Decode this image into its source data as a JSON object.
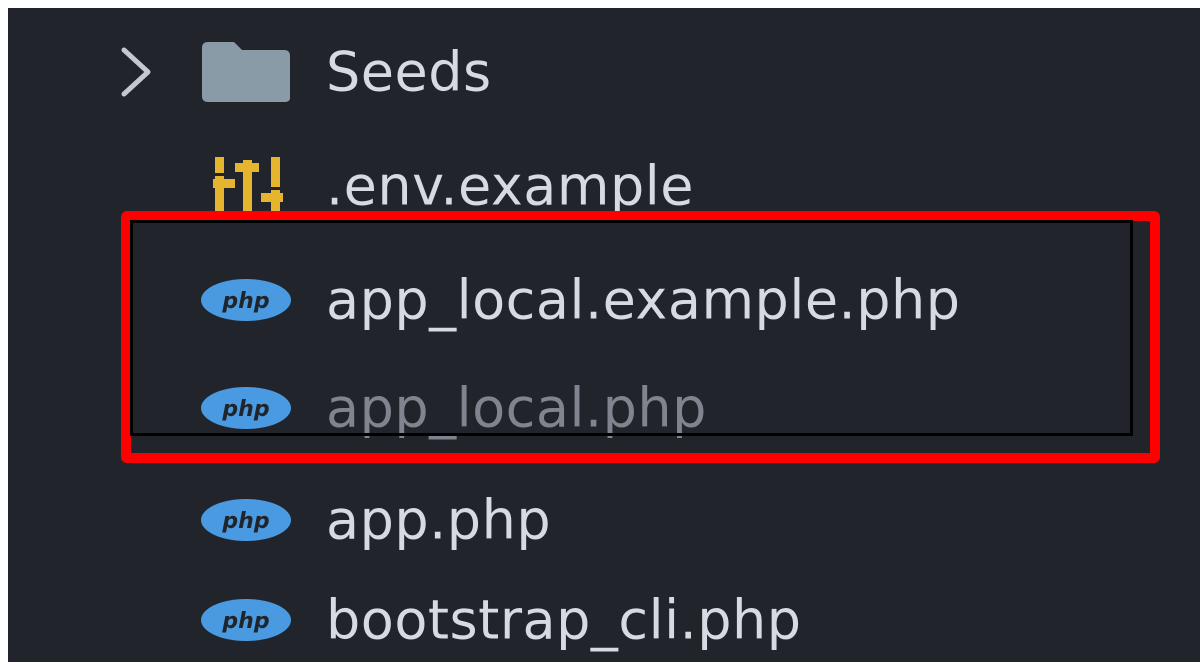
{
  "explorer": {
    "items": [
      {
        "label": "Seeds",
        "type": "folder",
        "icon": "folder-icon",
        "expanded": false
      },
      {
        "label": ".env.example",
        "type": "file",
        "icon": "settings-sliders-icon"
      },
      {
        "label": "app_local.example.php",
        "type": "file",
        "icon": "php-icon"
      },
      {
        "label": "app_local.php",
        "type": "file",
        "icon": "php-icon",
        "dimmed": true
      },
      {
        "label": "app.php",
        "type": "file",
        "icon": "php-icon"
      },
      {
        "label": "bootstrap_cli.php",
        "type": "file",
        "icon": "php-icon"
      }
    ],
    "php_icon_text": "php"
  },
  "colors": {
    "background": "#21252b",
    "text": "#d7dae0",
    "dimmed_text": "#7f848e",
    "folder": "#8a9ba8",
    "php_badge": "#4a9ae1",
    "env_icon": "#e5b52e",
    "highlight": "#ff0000"
  }
}
